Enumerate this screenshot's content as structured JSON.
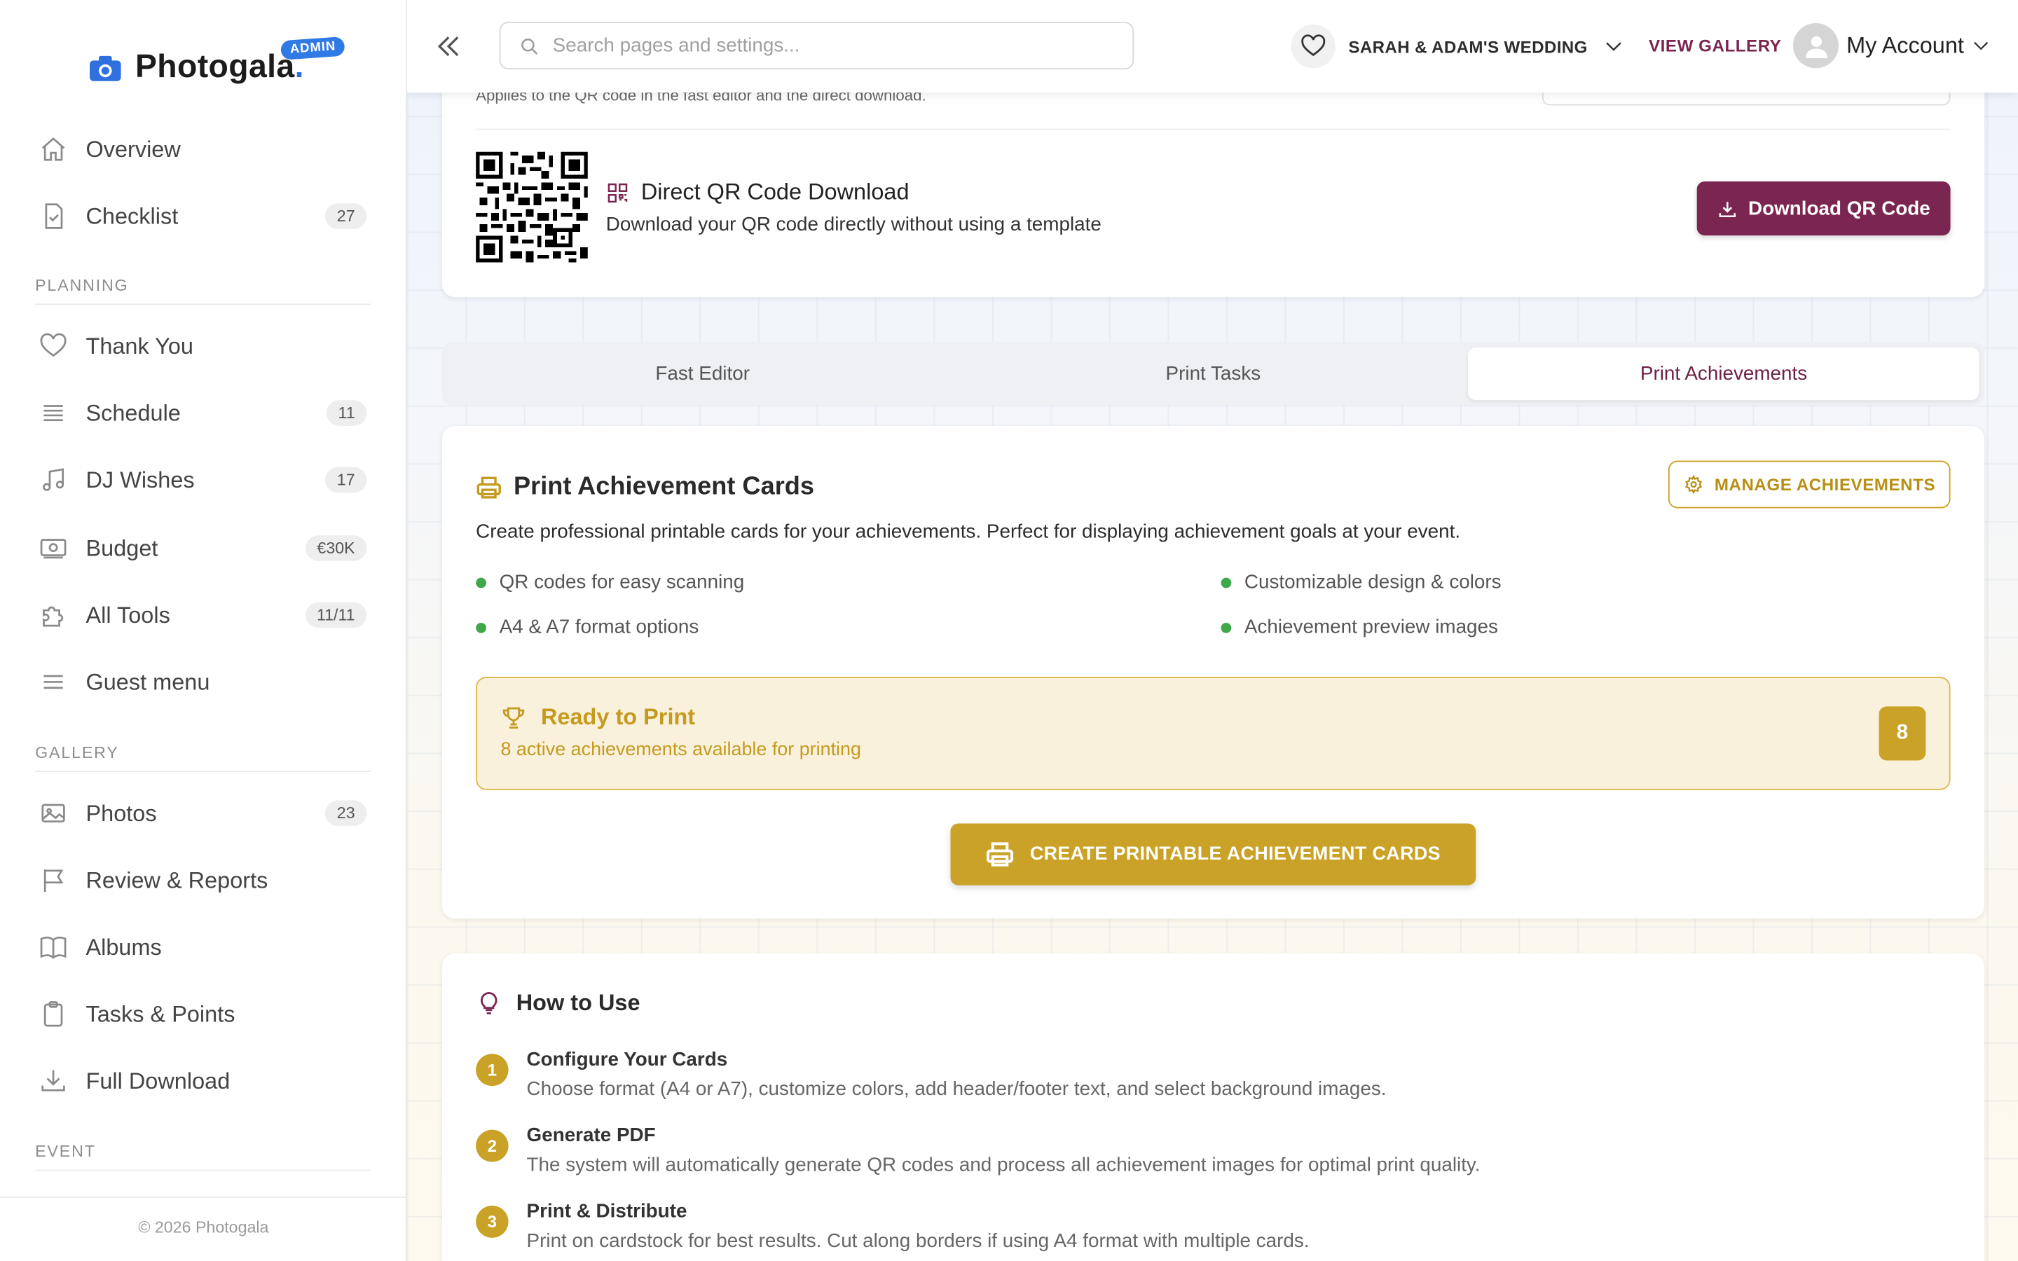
{
  "sidebar": {
    "brand": "Photogala",
    "brand_dot": ".",
    "badge": "ADMIN",
    "items_top": [
      {
        "label": "Overview",
        "count": ""
      },
      {
        "label": "Checklist",
        "count": "27"
      }
    ],
    "section_planning": "PLANNING",
    "items_planning": [
      {
        "label": "Thank You",
        "count": ""
      },
      {
        "label": "Schedule",
        "count": "11"
      },
      {
        "label": "DJ Wishes",
        "count": "17"
      },
      {
        "label": "Budget",
        "count": "€30K"
      },
      {
        "label": "All Tools",
        "count": "11/11"
      },
      {
        "label": "Guest menu",
        "count": ""
      }
    ],
    "section_gallery": "GALLERY",
    "items_gallery": [
      {
        "label": "Photos",
        "count": "23"
      },
      {
        "label": "Review & Reports",
        "count": ""
      },
      {
        "label": "Albums",
        "count": ""
      },
      {
        "label": "Tasks & Points",
        "count": ""
      },
      {
        "label": "Full Download",
        "count": ""
      }
    ],
    "section_event": "EVENT",
    "footer": "© 2026 Photogala"
  },
  "topbar": {
    "search_placeholder": "Search pages and settings...",
    "event_name": "SARAH & ADAM'S WEDDING",
    "view_gallery": "VIEW GALLERY",
    "account": "My Account"
  },
  "qr": {
    "note": "Applies to the QR code in the fast editor and the direct download.",
    "title": "Direct QR Code Download",
    "description": "Download your QR code directly without using a template",
    "button": "Download QR Code"
  },
  "tabs": [
    {
      "label": "Fast Editor",
      "active": false
    },
    {
      "label": "Print Tasks",
      "active": false
    },
    {
      "label": "Print Achievements",
      "active": true
    }
  ],
  "achievements": {
    "title": "Print Achievement Cards",
    "manage_button": "MANAGE ACHIEVEMENTS",
    "description": "Create professional printable cards for your achievements. Perfect for displaying achievement goals at your event.",
    "features": [
      "QR codes for easy scanning",
      "Customizable design & colors",
      "A4 & A7 format options",
      "Achievement preview images"
    ],
    "ready_title": "Ready to Print",
    "ready_subtitle": "8 active achievements available for printing",
    "ready_count": "8",
    "create_button": "CREATE PRINTABLE ACHIEVEMENT CARDS"
  },
  "how_to_use": {
    "title": "How to Use",
    "steps": [
      {
        "num": "1",
        "title": "Configure Your Cards",
        "desc": "Choose format (A4 or A7), customize colors, add header/footer text, and select background images."
      },
      {
        "num": "2",
        "title": "Generate PDF",
        "desc": "The system will automatically generate QR codes and process all achievement images for optimal print quality."
      },
      {
        "num": "3",
        "title": "Print & Distribute",
        "desc": "Print on cardstock for best results. Cut along borders if using A4 format with multiple cards."
      }
    ]
  },
  "colors": {
    "brand_blue": "#2f6fde",
    "maroon": "#7b2650",
    "gold": "#c9a227",
    "green": "#3ea84a"
  }
}
